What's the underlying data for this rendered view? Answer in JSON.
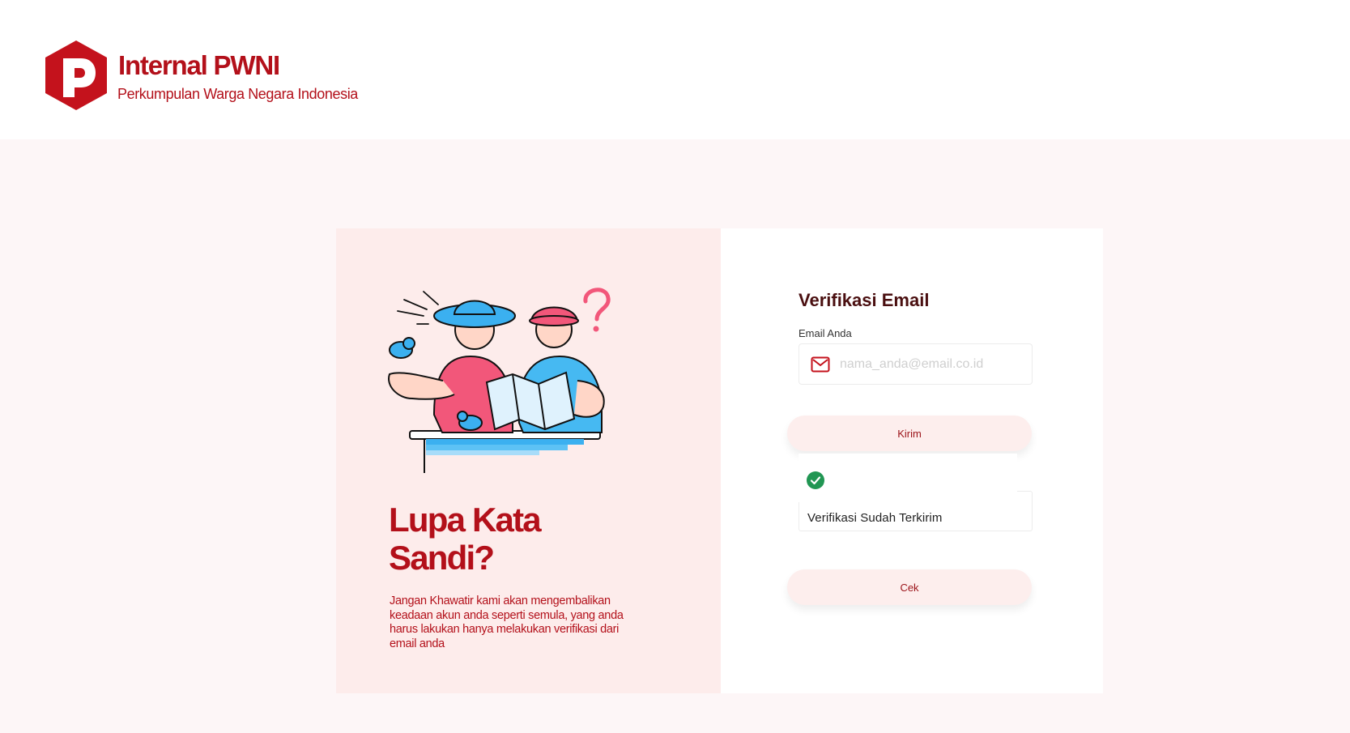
{
  "brand": {
    "title": "Internal PWNI",
    "subtitle": "Perkumpulan Warga Negara Indonesia",
    "logo_icon": "pwni-logo-icon"
  },
  "left_panel": {
    "heading": "Lupa Kata Sandi?",
    "description": "Jangan Khawatir kami akan mengembalikan keadaan akun anda seperti semula, yang anda harus lakukan hanya melakukan verifikasi dari email anda"
  },
  "form": {
    "title": "Verifikasi Email",
    "email_label": "Email Anda",
    "email_value": "",
    "email_placeholder": "nama_anda@email.co.id",
    "email_icon": "mail-icon",
    "send_label": "Kirim",
    "notice_text": "Verifikasi Sudah Terkirim",
    "notice_icon": "check-circle-icon",
    "check_label": "Cek"
  },
  "colors": {
    "brand_red": "#b3101a",
    "panel_pink": "#fdeceb",
    "page_bg": "#fdf6f7",
    "success_green": "#219653"
  }
}
